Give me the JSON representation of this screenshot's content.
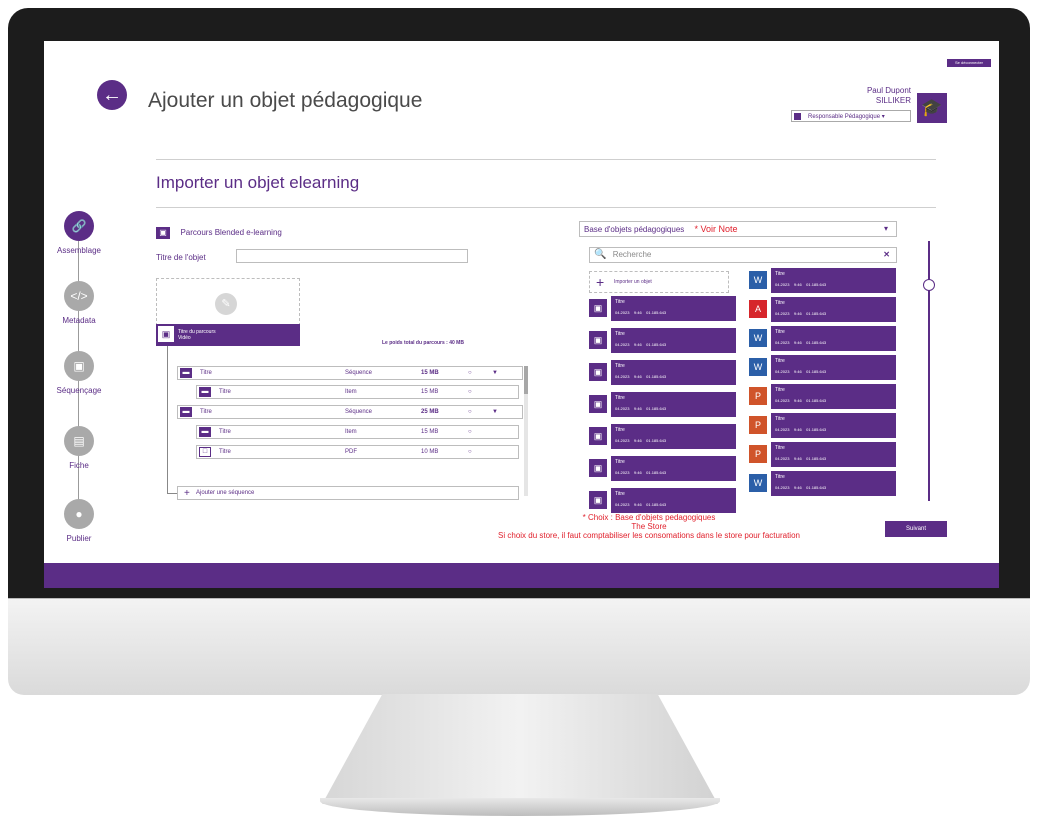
{
  "header": {
    "back_icon": "arrow-left-icon",
    "title": "Ajouter un objet pédagogique",
    "user_name": "Paul Dupont",
    "org": "SILLIKER",
    "role_select": "Responsable Pédagogique",
    "badge": "Se déconnecter",
    "avatar_icon": "graduation-cap-icon"
  },
  "section": {
    "title": "Importer un objet elearning"
  },
  "steps": [
    {
      "label": "Assemblage",
      "icon": "link-icon",
      "active": true
    },
    {
      "label": "Metadata",
      "icon": "code-icon",
      "active": false
    },
    {
      "label": "Séquençage",
      "icon": "sequence-icon",
      "active": false
    },
    {
      "label": "Fiche",
      "icon": "book-icon",
      "active": false
    },
    {
      "label": "Publier",
      "icon": "publish-icon",
      "active": false
    }
  ],
  "left": {
    "course_name": "Parcours Blended e-learning",
    "object_title_label": "Titre de l'objet",
    "object_title_value": "",
    "course_bar_title": "Titre du parcours",
    "course_bar_sub": "Vidéo",
    "total_weight": "Le poids total du parcours : 40 MB",
    "tree": [
      {
        "title": "Titre",
        "type": "Séquence",
        "size": "15 MB"
      },
      {
        "title": "Titre",
        "type": "Item",
        "size": "15 MB"
      },
      {
        "title": "Titre",
        "type": "Séquence",
        "size": "25 MB"
      },
      {
        "title": "Titre",
        "type": "Item",
        "size": "15 MB"
      },
      {
        "title": "Titre",
        "type": "PDF",
        "size": "10 MB"
      }
    ],
    "add_sequence": "Ajouter une séquence"
  },
  "right": {
    "base_select": "Base d'objets pédagogiques",
    "voir_note": "* Voir Note",
    "search_placeholder": "Recherche",
    "import_label": "Importer un objet",
    "col1": [
      {
        "title": "Titre",
        "meta": "04.2023    9:46    01.185.643"
      },
      {
        "title": "Titre",
        "meta": "04.2023    9:46    01.185.643"
      },
      {
        "title": "Titre",
        "meta": "04.2023    9:46    01.185.643"
      },
      {
        "title": "Titre",
        "meta": "04.2023    9:46    01.185.643"
      },
      {
        "title": "Titre",
        "meta": "04.2023    9:46    01.185.643"
      },
      {
        "title": "Titre",
        "meta": "04.2023    9:46    01.185.643"
      },
      {
        "title": "Titre",
        "meta": "04.2023    9:46    01.185.643"
      }
    ],
    "col2": [
      {
        "title": "Titre",
        "meta": "04.2023    9:46    01.185.643",
        "kind": "word"
      },
      {
        "title": "Titre",
        "meta": "04.2023    9:46    01.185.643",
        "kind": "pdf"
      },
      {
        "title": "Titre",
        "meta": "04.2023    9:46    01.185.643",
        "kind": "word"
      },
      {
        "title": "Titre",
        "meta": "04.2023    9:46    01.185.643",
        "kind": "word"
      },
      {
        "title": "Titre",
        "meta": "04.2023    9:46    01.185.643",
        "kind": "ppt"
      },
      {
        "title": "Titre",
        "meta": "04.2023    9:46    01.185.643",
        "kind": "ppt"
      },
      {
        "title": "Titre",
        "meta": "04.2023    9:46    01.185.643",
        "kind": "ppt"
      },
      {
        "title": "Titre",
        "meta": "04.2023    9:46    01.185.643",
        "kind": "word"
      }
    ]
  },
  "note": {
    "line1": "* Choix : Base d'objets pedagogiques",
    "line2": "The Store",
    "line3": "Si choix du store, il faut comptabiliser les consomations dans le store pour facturation"
  },
  "next_button": "Suivant",
  "colors": {
    "accent": "#5b2d86",
    "note": "#e0202c"
  }
}
